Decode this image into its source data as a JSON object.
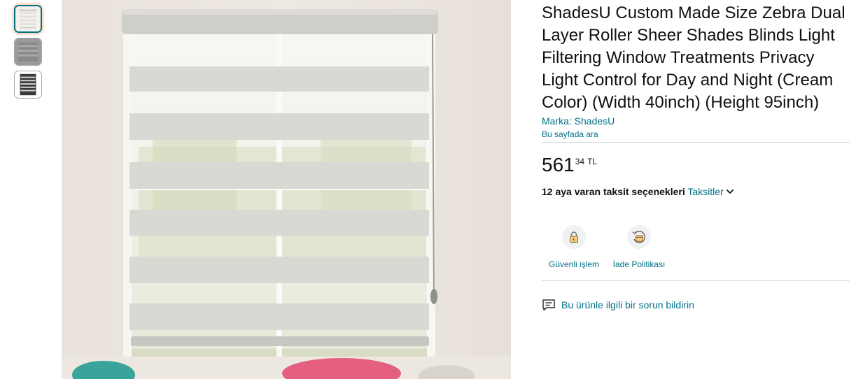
{
  "thumbnails": [
    {
      "name": "cream-blind-thumbnail",
      "selected": true
    },
    {
      "name": "gray-blind-thumbnail",
      "selected": false
    },
    {
      "name": "black-blind-thumbnail",
      "selected": false
    }
  ],
  "main_image": {
    "subject": "zebra-roller-shade-photo"
  },
  "product": {
    "title": "ShadesU Custom Made Size Zebra Dual Layer Roller Sheer Shades Blinds Light Filtering Window Treatments Privacy Light Control for Day and Night (Cream Color) (Width 40inch) (Height 95inch)",
    "brand": "Marka: ShadesU",
    "search_page": "Bu sayfada ara"
  },
  "price": {
    "whole": "561",
    "fraction": "34",
    "currency": "TL"
  },
  "installments": {
    "text": "12 aya varan taksit seçenekleri",
    "link": "Taksitler"
  },
  "features": {
    "secure": {
      "label": "Güvenli işlem",
      "icon": "lock-icon"
    },
    "returns": {
      "label": "İade Politikası",
      "icon": "return-box-icon"
    }
  },
  "report": {
    "label": "Bu ürünle ilgili bir sorun bildirin",
    "icon": "feedback-chat-icon"
  },
  "colors": {
    "link": "#007185",
    "divider": "#d5d9d9",
    "accent_orange": "#e47911"
  }
}
